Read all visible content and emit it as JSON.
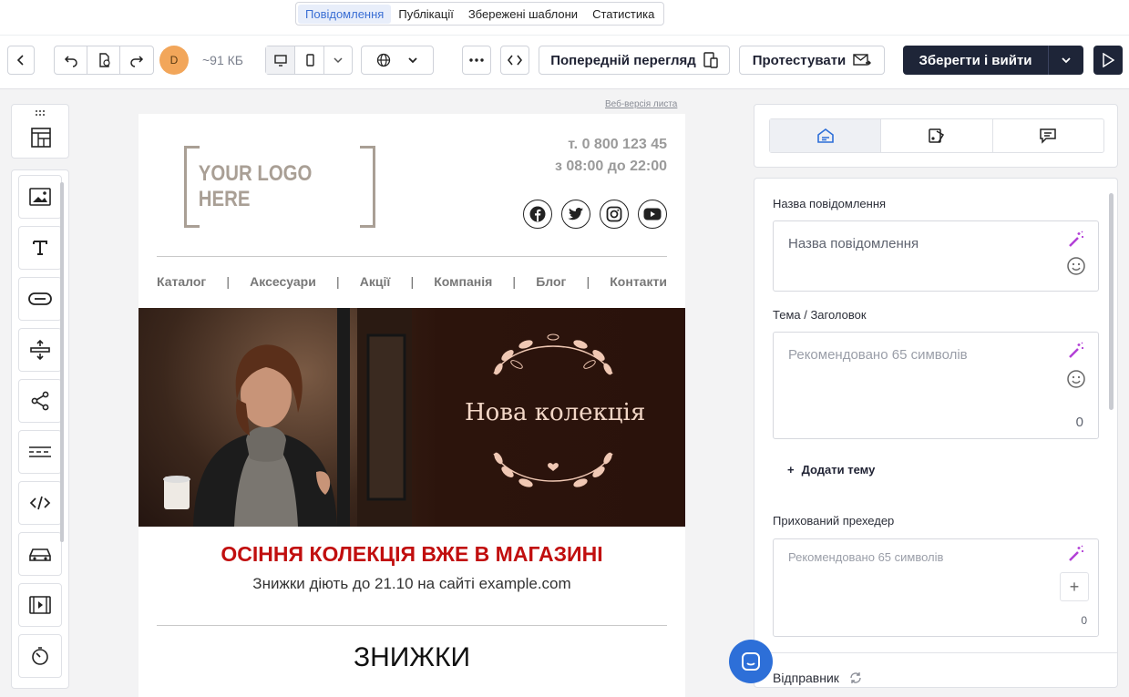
{
  "tabs": [
    "Повідомлення",
    "Публікації",
    "Збережені шаблони",
    "Статистика"
  ],
  "toolbar": {
    "avatar_letter": "D",
    "size": "~91 КБ",
    "preview_label": "Попередній перегляд",
    "test_label": "Протестувати",
    "save_label": "Зберегти і вийти"
  },
  "email": {
    "web_version": "Веб-версія листа",
    "logo": "YOUR LOGO HERE",
    "phone": "т. 0 800 123 45",
    "hours": "з 08:00 до 22:00",
    "nav": [
      "Каталог",
      "Аксесуари",
      "Акції",
      "Компанія",
      "Блог",
      "Контакти"
    ],
    "hero_title": "Нова колекція",
    "headline": "ОСІННЯ КОЛЕКЦІЯ ВЖЕ В МАГАЗИНІ",
    "subline": "Знижки діють до 21.10 на сайті example.com",
    "section_title": "ЗНИЖКИ"
  },
  "form": {
    "name_label": "Назва повідомлення",
    "name_placeholder": "Назва повідомлення",
    "subject_label": "Тема / Заголовок",
    "subject_placeholder": "Рекомендовано 65 символів",
    "subject_count": "0",
    "add_theme": "Додати тему",
    "preheader_label": "Прихований прехедер",
    "preheader_placeholder": "Рекомендовано 65 символів",
    "preheader_count": "0",
    "sender_label": "Відправник"
  },
  "colors": {
    "accent": "#3b6fd4",
    "dark": "#1e2538",
    "headline_red": "#c10f0f",
    "magic": "#b23fd6"
  }
}
